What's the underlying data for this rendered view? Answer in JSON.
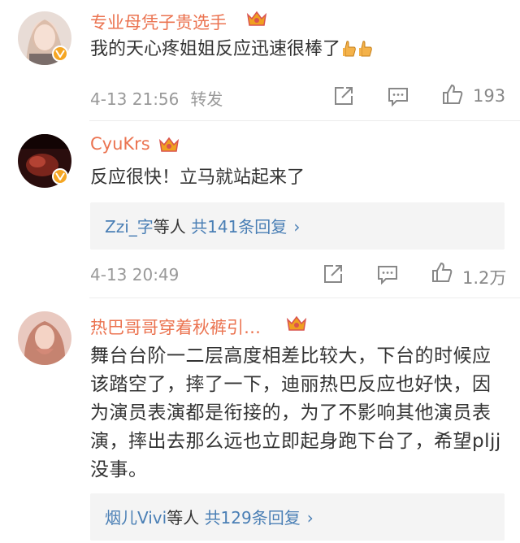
{
  "comments": [
    {
      "username": "专业母凭子贵选手",
      "text": "我的天心疼姐姐反应迅速很棒了",
      "emoji": [
        "thumbs-up-emoji",
        "thumbs-up-emoji"
      ],
      "timestamp": "4-13 21:56",
      "forward_label": "转发",
      "like_count": "193"
    },
    {
      "username": "CyuKrs",
      "text": "反应很快！立马就站起来了",
      "reply_summary": {
        "names": "Zzi_字",
        "suffix": "等人",
        "total": "共141条回复",
        "chevron": "›"
      },
      "timestamp": "4-13 20:49",
      "like_count": "1.2万"
    },
    {
      "username": "热巴哥哥穿着秋裤引…",
      "text": "舞台台阶一二层高度相差比较大，下台的时候应该踏空了，摔了一下，迪丽热巴反应也好快，因为演员表演都是衔接的，为了不影响其他演员表演，摔出去那么远也立即起身跑下台了，希望pljj没事。",
      "reply_summary": {
        "names": "烟儿Vivi",
        "suffix": "等人",
        "total": "共129条回复",
        "chevron": "›"
      }
    }
  ],
  "colors": {
    "username": "#eb7350",
    "link": "#4a7fb5",
    "meta": "#999999",
    "badge": "#f5a623",
    "crown": "#f0a020"
  }
}
